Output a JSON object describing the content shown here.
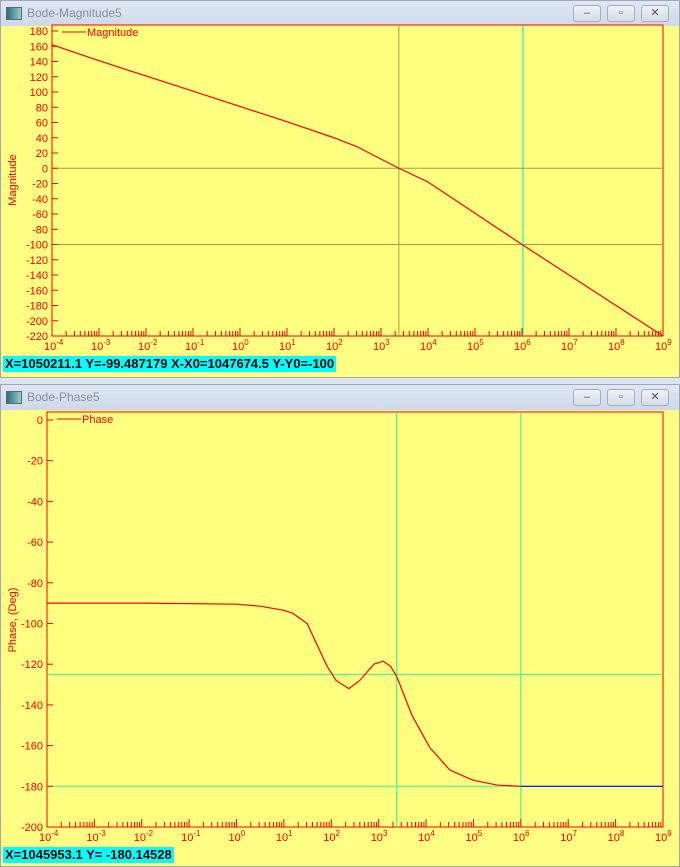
{
  "windows": [
    {
      "title": "Bode-Magnitude5",
      "status": "X=1050211.1  Y=-99.487179 X-X0=1047674.5 Y-Y0=-100"
    },
    {
      "title": "Bode-Phase5",
      "status": "X=1045953.1  Y= -180.14528"
    }
  ],
  "buttons": {
    "minimize": "‒",
    "maximize": "▫",
    "close": "✕"
  },
  "colors": {
    "plot_bg": "#ffff80",
    "axis": "#ff0000",
    "cursor_mag_1": "#a0a040",
    "cursor_mag_2": "#00e0c0",
    "cursor_phase": "#30f090",
    "trace_tail": "#0000ff"
  },
  "chart_data": [
    {
      "type": "line",
      "title": "",
      "legend": "Magnitude",
      "legend_placement": "top-left",
      "ylabel": "Magnitude",
      "xscale": "log",
      "xlim_exp": [
        -4,
        9
      ],
      "ylim": [
        -220,
        180
      ],
      "ytick_step": 20,
      "x_log10": [
        -4,
        -3,
        -2,
        -1,
        0,
        1,
        2,
        2.5,
        3,
        3.38,
        4,
        5,
        6,
        7,
        8,
        9
      ],
      "y": [
        162,
        141,
        121,
        101,
        81,
        61,
        40,
        28,
        12,
        0,
        -18,
        -59,
        -100,
        -140,
        -180,
        -220
      ],
      "cursors": {
        "x_log10": [
          3.38,
          6.02
        ],
        "y": [
          0,
          -100
        ]
      }
    },
    {
      "type": "line",
      "title": "",
      "legend": "Phase",
      "legend_placement": "top-left",
      "ylabel": "Phase, (Deg)",
      "xscale": "log",
      "xlim_exp": [
        -4,
        9
      ],
      "ylim": [
        -200,
        0
      ],
      "ytick_step": 20,
      "x_log10": [
        -4,
        -2,
        0,
        0.5,
        1,
        1.19,
        1.49,
        1.91,
        2.1,
        2.37,
        2.6,
        2.9,
        3.09,
        3.25,
        3.38,
        3.7,
        4.08,
        4.5,
        4.99,
        5.5,
        6,
        9
      ],
      "y": [
        -90,
        -90,
        -90.5,
        -91.5,
        -93.5,
        -95,
        -100,
        -121,
        -128,
        -132,
        -128,
        -120,
        -118.5,
        -121,
        -126,
        -145,
        -161,
        -172,
        -177,
        -179.4,
        -180,
        -180
      ],
      "cursors": {
        "x_log10": [
          3.38,
          6.0
        ],
        "y": [
          -125,
          -180
        ]
      }
    }
  ]
}
